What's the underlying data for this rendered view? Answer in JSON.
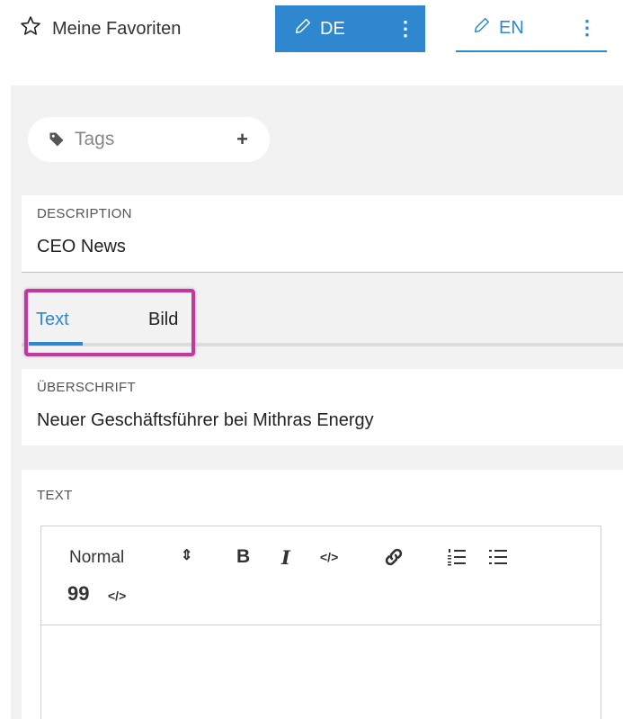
{
  "header": {
    "favorites_label": "Meine Favoriten",
    "lang_active": "DE",
    "lang_other": "EN",
    "kebab": "⋮"
  },
  "tags": {
    "label": "Tags",
    "add": "+"
  },
  "description": {
    "label": "DESCRIPTION",
    "value": "CEO News"
  },
  "tabs": [
    {
      "label": "Text",
      "active": true
    },
    {
      "label": "Bild",
      "active": false
    }
  ],
  "heading": {
    "label": "ÜBERSCHRIFT",
    "value": "Neuer Geschäftsführer bei Mithras Energy"
  },
  "text_section": {
    "label": "TEXT"
  },
  "editor": {
    "format_select": "Normal",
    "select_arrows": "⇕",
    "bold": "B",
    "italic": "I",
    "code": "</>",
    "quote": "99",
    "code_block": "</>"
  },
  "colors": {
    "accent": "#2f87d0",
    "highlight": "#c0399d",
    "panel": "#f2f2f2"
  }
}
